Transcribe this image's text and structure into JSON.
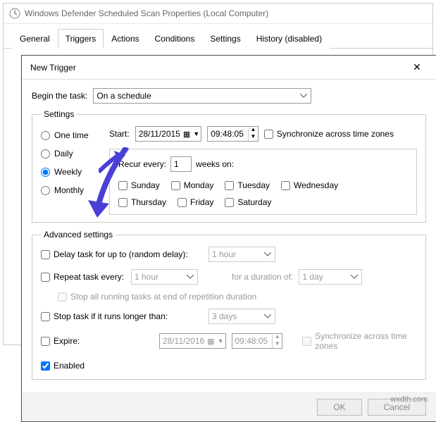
{
  "window": {
    "title": "Windows Defender Scheduled Scan Properties (Local Computer)"
  },
  "tabs": {
    "general": "General",
    "triggers": "Triggers",
    "actions": "Actions",
    "conditions": "Conditions",
    "settings": "Settings",
    "history": "History (disabled)"
  },
  "dialog": {
    "title": "New Trigger",
    "begin_label": "Begin the task:",
    "begin_value": "On a schedule",
    "settings_legend": "Settings",
    "radios": {
      "one_time": "One time",
      "daily": "Daily",
      "weekly": "Weekly",
      "monthly": "Monthly"
    },
    "start_label": "Start:",
    "start_date": "28/11/2015",
    "start_time": "09:48:05",
    "sync_tz": "Synchronize across time zones",
    "recur": {
      "prefix": "Recur every:",
      "value": "1",
      "suffix": "weeks on:"
    },
    "days": {
      "sunday": "Sunday",
      "monday": "Monday",
      "tuesday": "Tuesday",
      "wednesday": "Wednesday",
      "thursday": "Thursday",
      "friday": "Friday",
      "saturday": "Saturday"
    },
    "adv_legend": "Advanced settings",
    "adv": {
      "delay_label": "Delay task for up to (random delay):",
      "delay_value": "1 hour",
      "repeat_label": "Repeat task every:",
      "repeat_value": "1 hour",
      "duration_label": "for a duration of:",
      "duration_value": "1 day",
      "stop_all": "Stop all running tasks at end of repetition duration",
      "stop_if_label": "Stop task if it runs longer than:",
      "stop_if_value": "3 days",
      "expire_label": "Expire:",
      "expire_date": "28/11/2016",
      "expire_time": "09:48:05",
      "expire_sync": "Synchronize across time zones",
      "enabled": "Enabled"
    },
    "buttons": {
      "ok": "OK",
      "cancel": "Cancel"
    }
  },
  "footer_credit": "wxdth.com"
}
